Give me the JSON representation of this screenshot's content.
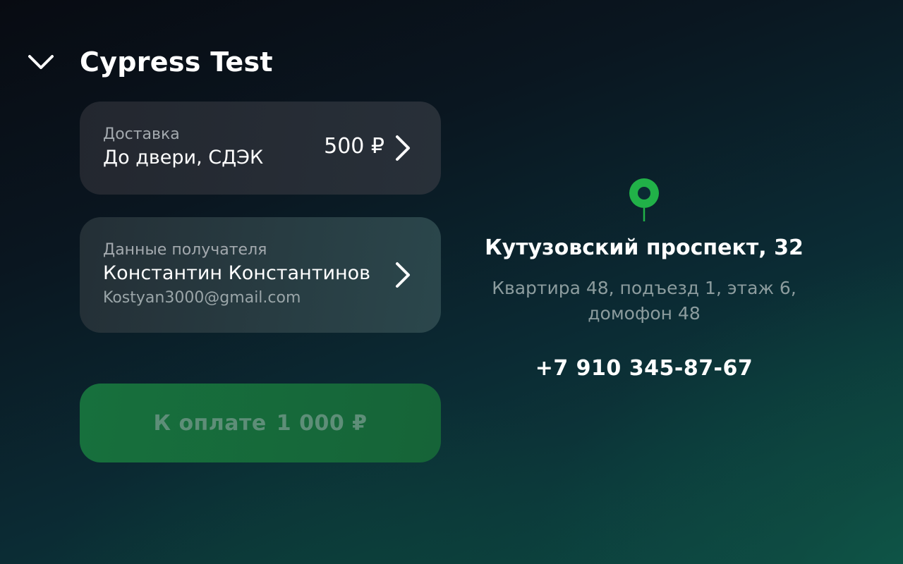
{
  "header": {
    "back_icon": "chevron-down-icon",
    "title": "Cypress Test"
  },
  "delivery": {
    "label": "Доставка",
    "method": "До двери, СДЭК",
    "price": "500 ₽",
    "icon": "chevron-right-icon"
  },
  "recipient": {
    "label": "Данные получателя",
    "name": "Константин Константинов",
    "email": "Kostyan3000@gmail.com",
    "icon": "chevron-right-icon"
  },
  "payment": {
    "label": "К оплате",
    "amount": "1 000 ₽",
    "accent": "#17703d"
  },
  "address": {
    "icon": "map-pin-icon",
    "pin_color": "#21b148",
    "street": "Кутузовский проспект, 32",
    "details_line1": "Квартира 48, подъезд 1, этаж 6,",
    "details_line2": "домофон 48",
    "phone": "+7 910 345-87-67"
  }
}
